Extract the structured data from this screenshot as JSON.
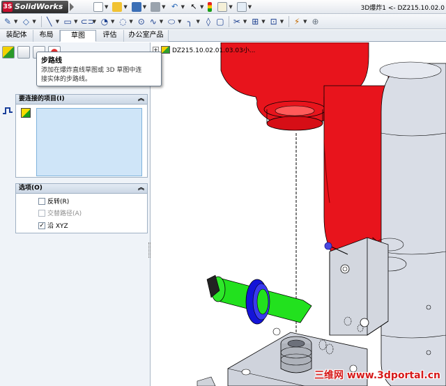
{
  "app": {
    "logo_text": "SolidWorks",
    "window_title": "3D爆炸1 <- DZ215.10.02.0"
  },
  "tabs": [
    "装配体",
    "布局",
    "草图",
    "评估",
    "办公室产品"
  ],
  "active_tab": "草图",
  "feature_tree": {
    "root_label": "DZ215.10.02.01.03.03小..."
  },
  "tooltip": {
    "title": "步路线",
    "body_line1": "添加在爆炸直线草图或 3D 草图中连",
    "body_line2": "接实体的步路线。"
  },
  "property_manager": {
    "items_group": {
      "title": "要连接的项目(I)"
    },
    "options_group": {
      "title": "选项(O)",
      "options": [
        {
          "label": "反转(R)",
          "checked": false,
          "enabled": true
        },
        {
          "label": "交替路径(A)",
          "checked": false,
          "enabled": false
        },
        {
          "label": "沿 XYZ",
          "checked": true,
          "enabled": true
        }
      ]
    }
  },
  "watermark": "三维网 www.3dportal.cn",
  "colors": {
    "red_part": "#e8141c",
    "green_part": "#22e11e",
    "blue_ring": "#1414d8",
    "grey_body": "#c8cdd6",
    "list_bg": "#cfe5f8"
  },
  "icons": {
    "toolbar": [
      "sketch-icon",
      "smart-dimension-icon",
      "line-icon",
      "rectangle-icon",
      "slot-icon",
      "circle-icon",
      "arc-icon",
      "polygon-icon",
      "spline-icon",
      "ellipse-icon",
      "fillet-icon",
      "mirror-icon",
      "offset-icon",
      "trim-icon",
      "move-icon",
      "relation-icon",
      "rapid-sketch-icon",
      "zoom-icon"
    ]
  }
}
